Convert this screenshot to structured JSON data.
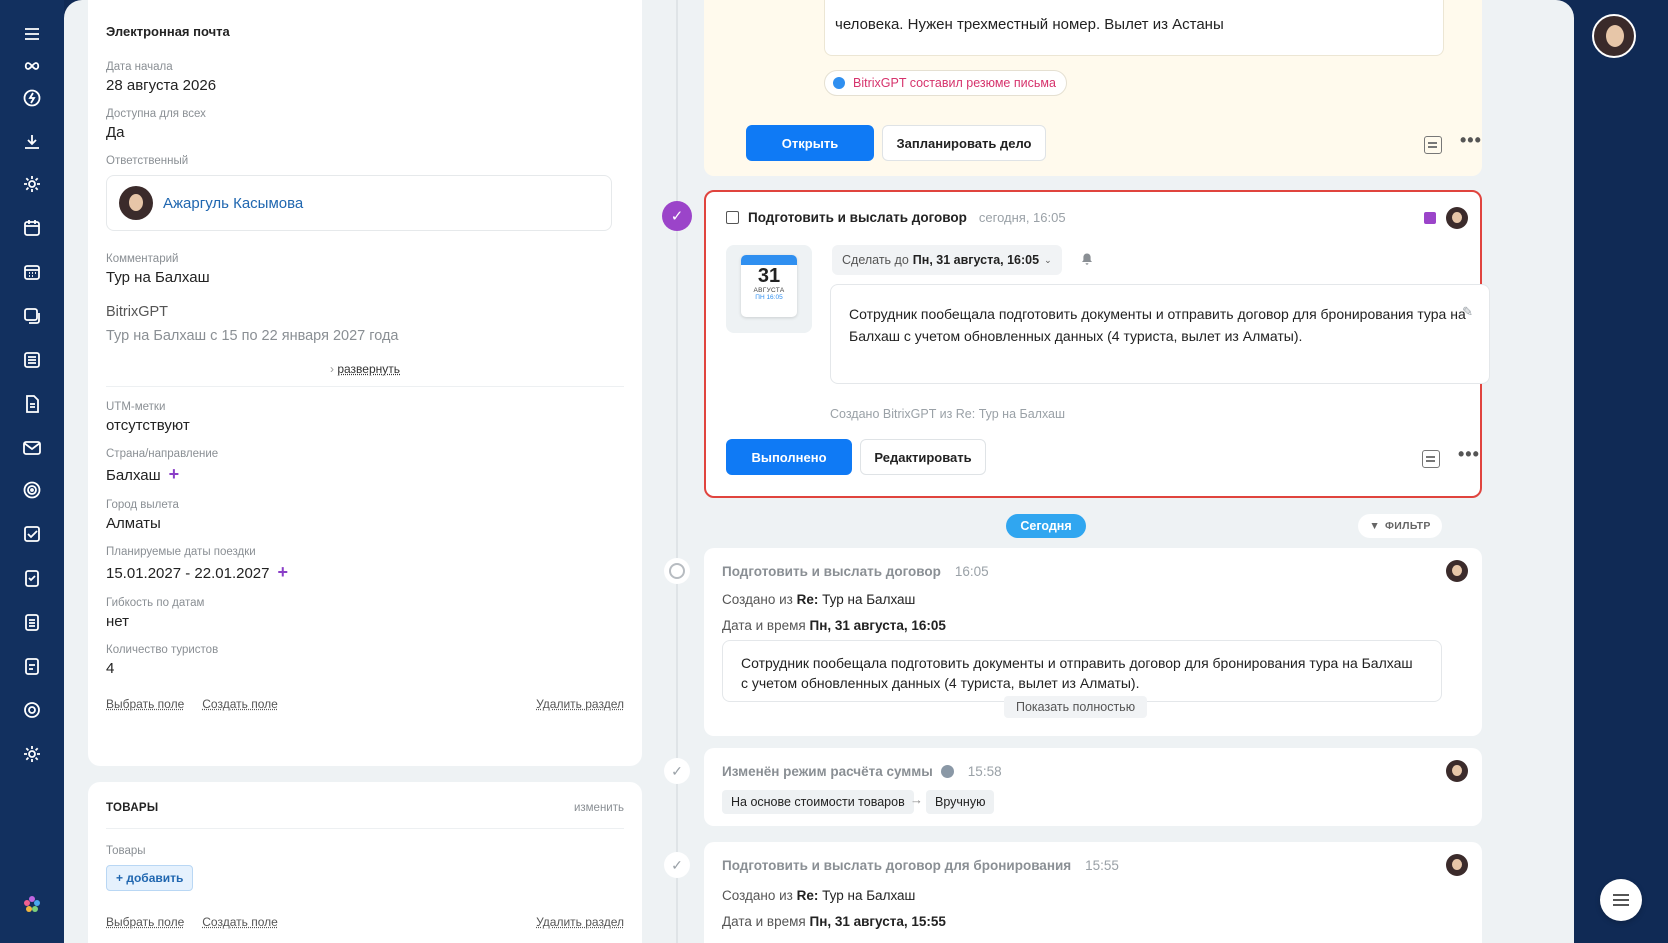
{
  "rail": {
    "icons": [
      "menu-icon",
      "infinity-icon",
      "lightning-icon",
      "download-icon",
      "settings-icon",
      "calendar-icon",
      "calendar-grid-icon",
      "chat-icon",
      "list-icon",
      "document-icon",
      "mail-icon",
      "target-icon",
      "task-check-icon",
      "clipboard-icon",
      "clipboard-list-icon",
      "clipboard-alt-icon",
      "gear-icon",
      "gear-alt-icon",
      "bitrix-flower-icon"
    ]
  },
  "info": {
    "section_title": "Электронная почта",
    "start_date_label": "Дата начала",
    "start_date_value": "28 августа 2026",
    "available_label": "Доступна для всех",
    "available_value": "Да",
    "responsible_label": "Ответственный",
    "responsible_name": "Ажаргуль Касымова",
    "comment_label": "Комментарий",
    "comment_value": "Тур на Балхаш",
    "gpt_title": "BitrixGPT",
    "gpt_text": "Тур на Балхаш с 15 по 22 января 2027 года",
    "expand_label": "развернуть",
    "utm_label": "UTM-метки",
    "utm_value": "отсутствуют",
    "country_label": "Страна/направление",
    "country_value": "Балхаш",
    "city_label": "Город вылета",
    "city_value": "Алматы",
    "dates_label": "Планируемые даты поездки",
    "dates_value": "15.01.2027 - 22.01.2027",
    "flex_label": "Гибкость по датам",
    "flex_value": "нет",
    "tourists_label": "Количество туристов",
    "tourists_value": "4",
    "select_field": "Выбрать поле",
    "create_field": "Создать поле",
    "delete_section": "Удалить раздел"
  },
  "goods": {
    "title": "ТОВАРЫ",
    "edit": "изменить",
    "label": "Товары",
    "add": "+ добавить",
    "select_field": "Выбрать поле",
    "create_field": "Создать поле",
    "delete_section": "Удалить раздел"
  },
  "email_card": {
    "quote": "человека. Нужен трехместный номер. Вылет из Астаны",
    "gpt_chip": "BitrixGPT составил резюме письма",
    "open_button": "Открыть",
    "plan_button": "Запланировать дело"
  },
  "task_card": {
    "title": "Подготовить и выслать договор",
    "time": "сегодня, 16:05",
    "cal_day": "31",
    "cal_month": "АВГУСТА",
    "cal_time": "ПН 16:05",
    "deadline_prefix": "Сделать до",
    "deadline_value": "Пн, 31 августа, 16:05",
    "description": "Сотрудник пообещала подготовить документы и отправить договор для бронирования тура на Балхаш с учетом обновленных данных (4 туриста, вылет из Алматы).",
    "created": "Создано BitrixGPT из Re: Тур на Балхаш",
    "done_button": "Выполнено",
    "edit_button": "Редактировать"
  },
  "timeline": {
    "today_label": "Сегодня",
    "filter_label": "ФИЛЬТР",
    "items": [
      {
        "title": "Подготовить и выслать договор",
        "time": "16:05",
        "created_prefix": "Создано из",
        "created_bold": "Re:",
        "created_rest": "Тур на Балхаш",
        "datetime_prefix": "Дата и время",
        "datetime_value": "Пн, 31 августа, 16:05",
        "description": "Сотрудник пообещала подготовить документы и отправить договор для бронирования тура на Балхаш с учетом обновленных данных (4 туриста, вылет из Алматы).",
        "show_all": "Показать полностью"
      },
      {
        "title": "Изменён режим расчёта суммы",
        "time": "15:58",
        "from": "На основе стоимости товаров",
        "to": "Вручную"
      },
      {
        "title": "Подготовить и выслать договор для бронирования",
        "time": "15:55",
        "created_prefix": "Создано из",
        "created_bold": "Re:",
        "created_rest": "Тур на Балхаш",
        "datetime_prefix": "Дата и время",
        "datetime_value": "Пн, 31 августа, 15:55"
      }
    ]
  },
  "colors": {
    "primary": "#0f7af5",
    "accent_purple": "#9b44c9",
    "highlight_border": "#e0443e",
    "today_pill": "#30a6f0",
    "nav_background": "#12305f"
  }
}
